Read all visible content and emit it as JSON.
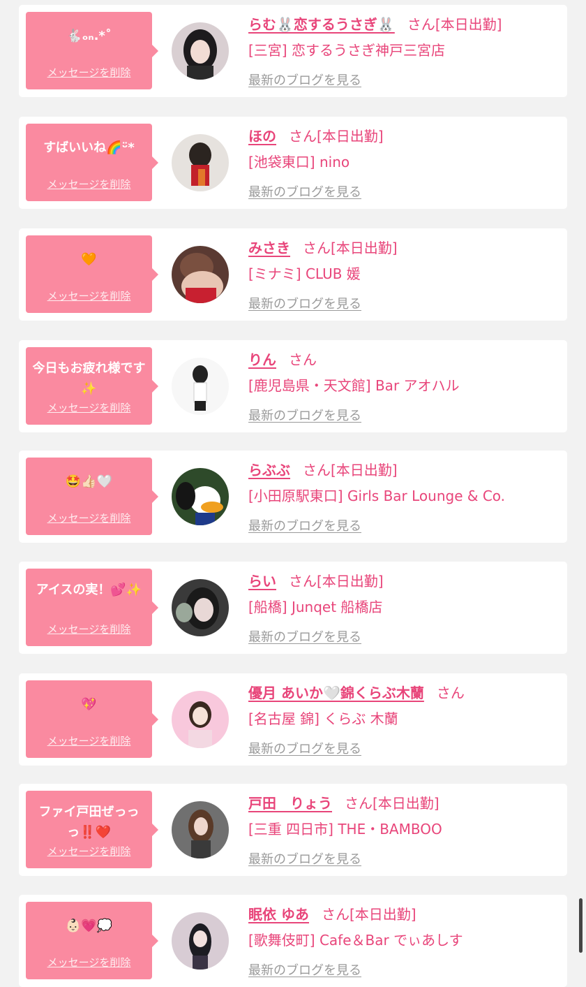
{
  "common": {
    "delete_label": "メッセージを削除",
    "blog_label": "最新のブログを見る",
    "honorific": "さん"
  },
  "colors": {
    "page_bg": "#f2f2f2",
    "bubble_bg": "#fa8aa0",
    "accent": "#e8457a",
    "link_gray": "#9a9a9a"
  },
  "items": [
    {
      "message": "🐇ₒₙ.*˚",
      "name": "らむ🐰恋するうさぎ🐰",
      "status": "[本日出勤]",
      "shop": "[三宮] 恋するうさぎ神戸三宮店"
    },
    {
      "message": "すばいいね🌈ᵕ̈*",
      "name": "ほの",
      "status": "[本日出勤]",
      "shop": "[池袋東口] nino"
    },
    {
      "message": "🧡",
      "name": "みさき",
      "status": "[本日出勤]",
      "shop": "[ミナミ] CLUB 媛"
    },
    {
      "message": "今日もお疲れ様です✨",
      "name": "りん",
      "status": "",
      "shop": "[鹿児島県・天文館] Bar アオハル"
    },
    {
      "message": "🤩👍🏻🤍",
      "name": "らぶぶ",
      "status": "[本日出勤]",
      "shop": "[小田原駅東口] Girls Bar Lounge & Co."
    },
    {
      "message": "アイスの実！💕✨",
      "name": "らい",
      "status": "[本日出勤]",
      "shop": "[船橋] Junqet 船橋店"
    },
    {
      "message": "💖",
      "name": "優月 あいか🤍錦くらぶ木蘭",
      "status": "",
      "shop": "[名古屋 錦] くらぶ 木蘭"
    },
    {
      "message": "ファイ戸田ぜっっっ‼️❤️",
      "name": "戸田　りょう",
      "status": "[本日出勤]",
      "shop": "[三重 四日市] THE・BAMBOO"
    },
    {
      "message": "👶🏻💗💭",
      "name": "眠依 ゆあ",
      "status": "[本日出勤]",
      "shop": "[歌舞伎町] Cafe＆Bar でぃあしす"
    }
  ]
}
